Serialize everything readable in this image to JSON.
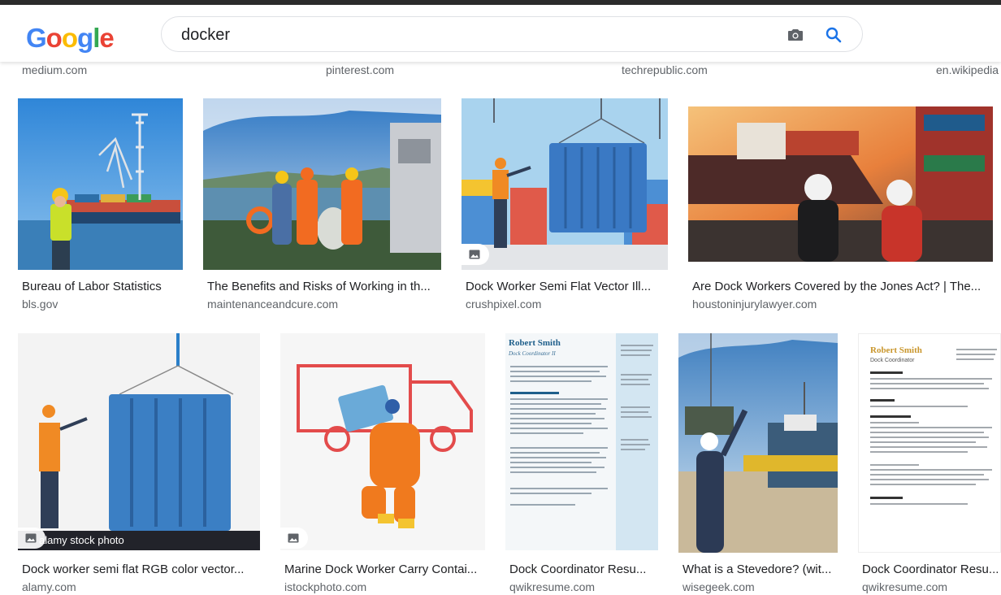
{
  "search": {
    "logo_letters": [
      "G",
      "o",
      "o",
      "g",
      "l",
      "e"
    ],
    "query": "docker"
  },
  "sources_row": [
    "medium.com",
    "pinterest.com",
    "techrepublic.com",
    "en.wikipedia"
  ],
  "results_row1": [
    {
      "title": "Bureau of Labor Statistics",
      "domain": "bls.gov"
    },
    {
      "title": "The Benefits and Risks of Working in th...",
      "domain": "maintenanceandcure.com"
    },
    {
      "title": "Dock Worker Semi Flat Vector Ill...",
      "domain": "crushpixel.com"
    },
    {
      "title": "Are Dock Workers Covered by the Jones Act? | The...",
      "domain": "houstoninjurylawyer.com"
    }
  ],
  "results_row2": [
    {
      "title": "Dock worker semi flat RGB color vector...",
      "domain": "alamy.com"
    },
    {
      "title": "Marine Dock Worker Carry Contai...",
      "domain": "istockphoto.com"
    },
    {
      "title": "Dock Coordinator Resu...",
      "domain": "qwikresume.com"
    },
    {
      "title": "What is a Stevedore? (wit...",
      "domain": "wisegeek.com"
    },
    {
      "title": "Dock Coordinator Resu...",
      "domain": "qwikresume.com"
    }
  ],
  "image_text": {
    "alamy_watermark": "alamy stock photo",
    "resume_name_1": "Robert Smith",
    "resume_role_1": "Dock Coordinator II",
    "resume_name_2": "Robert Smith",
    "resume_role_2": "Dock Coordinator"
  },
  "colors": {
    "accent_blue": "#1a73e8",
    "text_dark": "#202124",
    "text_grey": "#5f6368"
  },
  "icons": [
    "camera-icon",
    "search-icon",
    "image-badge-icon"
  ]
}
